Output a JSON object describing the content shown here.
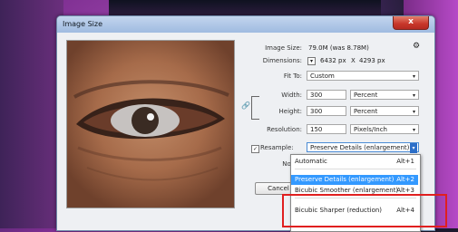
{
  "dialog": {
    "title": "Image Size",
    "close_label": "x"
  },
  "image_size": {
    "label": "Image Size:",
    "value": "79.0M (was 8.78M)"
  },
  "dimensions": {
    "label": "Dimensions:",
    "w": "6432 px",
    "x": "X",
    "h": "4293 px"
  },
  "fit_to": {
    "label": "Fit To:",
    "value": "Custom"
  },
  "width": {
    "label": "Width:",
    "value": "300",
    "unit": "Percent"
  },
  "height": {
    "label": "Height:",
    "value": "300",
    "unit": "Percent"
  },
  "resolution": {
    "label": "Resolution:",
    "value": "150",
    "unit": "Pixels/Inch"
  },
  "resample": {
    "label": "Resample:",
    "value": "Preserve Details (enlargement)",
    "checked": "✓"
  },
  "noise": {
    "label": "Noise:"
  },
  "buttons": {
    "cancel": "Cancel"
  },
  "menu": {
    "items": [
      {
        "label": "Automatic",
        "shortcut": "Alt+1"
      },
      {
        "label": "Preserve Details (enlargement)",
        "shortcut": "Alt+2"
      },
      {
        "label": "Bicubic Smoother (enlargement)",
        "shortcut": "Alt+3"
      },
      {
        "label": "Bicubic Sharper (reduction)",
        "shortcut": "Alt+4"
      }
    ]
  },
  "icons": {
    "gear": "⚙",
    "link": "🔗",
    "arrow": "▾"
  },
  "colors": {
    "highlight": "#e01f1f",
    "selection": "#3399ff"
  }
}
